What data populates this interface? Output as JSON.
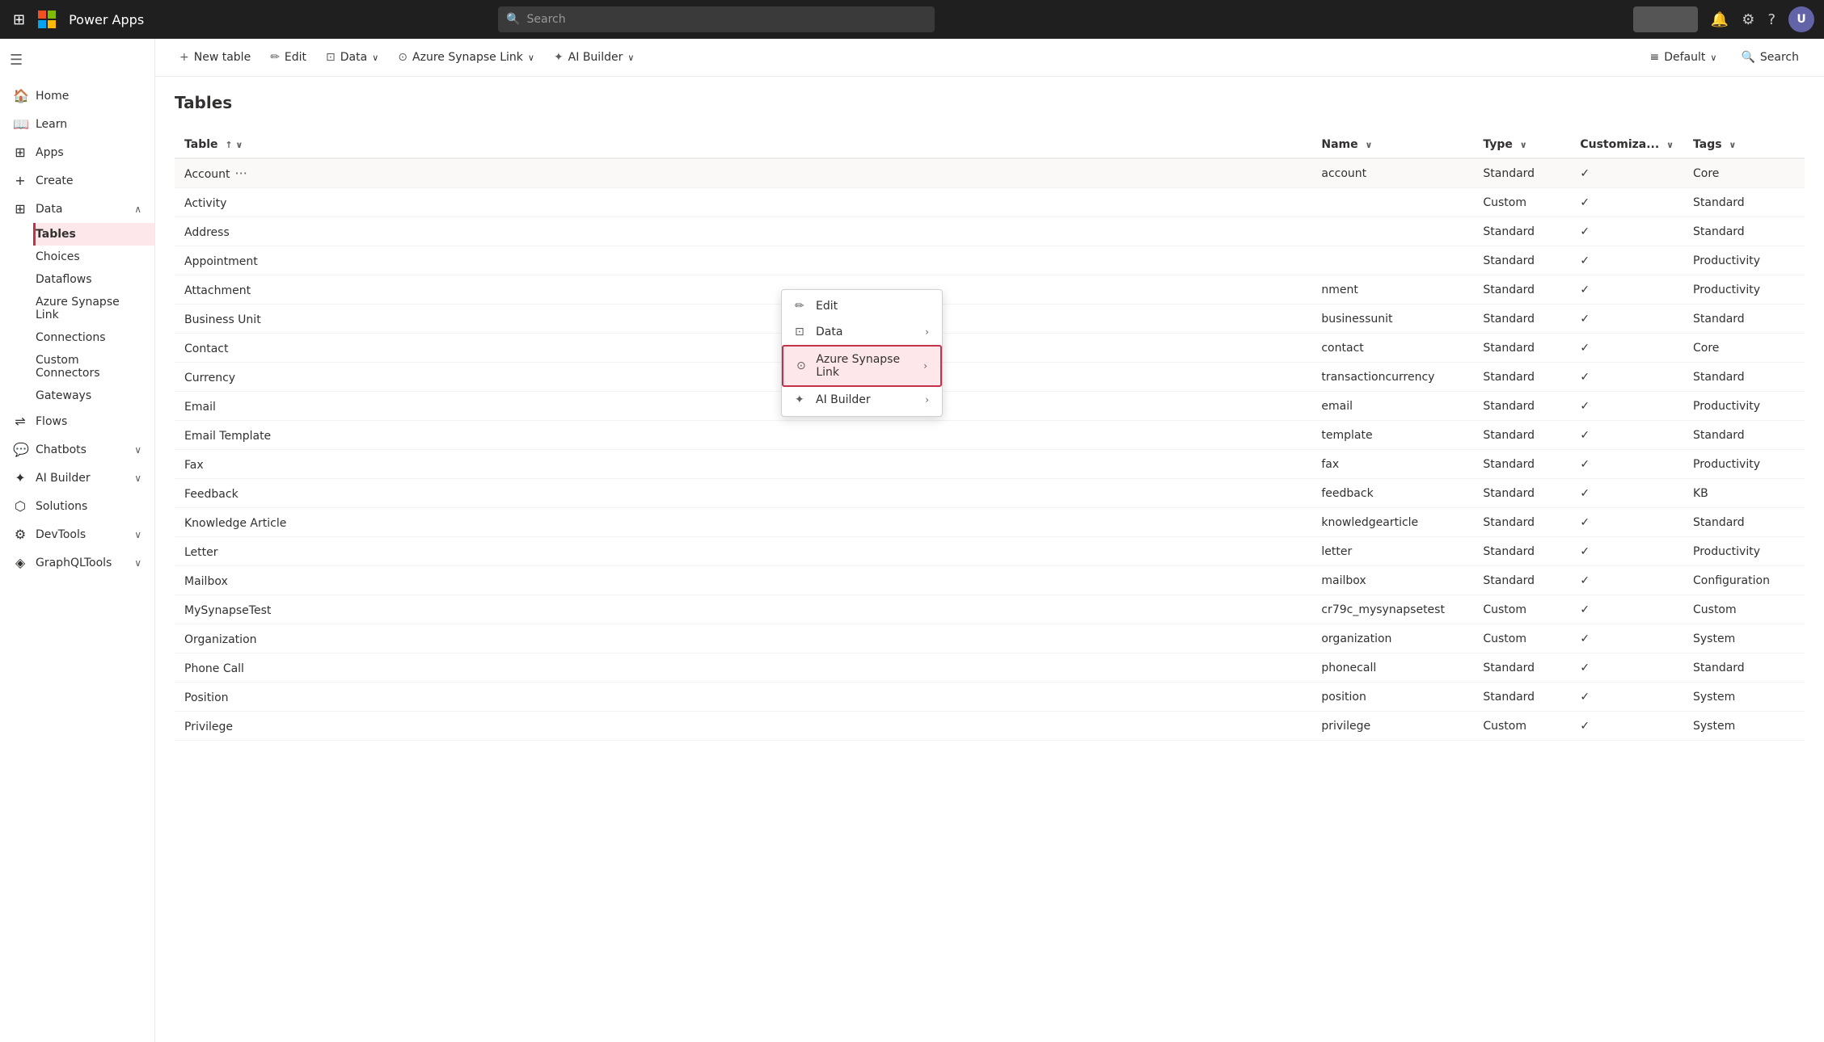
{
  "topNav": {
    "appTitle": "Power Apps",
    "searchPlaceholder": "Search",
    "waffleIcon": "⊞"
  },
  "sidebar": {
    "collapseIcon": "☰",
    "items": [
      {
        "id": "home",
        "label": "Home",
        "icon": "🏠"
      },
      {
        "id": "learn",
        "label": "Learn",
        "icon": "📖"
      },
      {
        "id": "apps",
        "label": "Apps",
        "icon": "⊞"
      },
      {
        "id": "create",
        "label": "Create",
        "icon": "+"
      },
      {
        "id": "data",
        "label": "Data",
        "icon": "⊞",
        "expanded": true,
        "hasChevron": true,
        "chevron": "∧"
      },
      {
        "id": "flows",
        "label": "Flows",
        "icon": "⇌"
      },
      {
        "id": "chatbots",
        "label": "Chatbots",
        "icon": "💬",
        "hasChevron": true,
        "chevron": "∨"
      },
      {
        "id": "ai-builder",
        "label": "AI Builder",
        "icon": "✦",
        "hasChevron": true,
        "chevron": "∨"
      },
      {
        "id": "solutions",
        "label": "Solutions",
        "icon": "⬡"
      },
      {
        "id": "devtools",
        "label": "DevTools",
        "icon": "⚙",
        "hasChevron": true,
        "chevron": "∨"
      },
      {
        "id": "graphqltools",
        "label": "GraphQLTools",
        "icon": "◈",
        "hasChevron": true,
        "chevron": "∨"
      }
    ],
    "dataSubItems": [
      {
        "id": "tables",
        "label": "Tables",
        "active": true
      },
      {
        "id": "choices",
        "label": "Choices"
      },
      {
        "id": "dataflows",
        "label": "Dataflows"
      },
      {
        "id": "azure-synapse-link",
        "label": "Azure Synapse Link"
      },
      {
        "id": "connections",
        "label": "Connections"
      },
      {
        "id": "custom-connectors",
        "label": "Custom Connectors"
      },
      {
        "id": "gateways",
        "label": "Gateways"
      }
    ]
  },
  "toolbar": {
    "newTableLabel": "+ New table",
    "editLabel": "✏ Edit",
    "dataLabel": "⊡ Data",
    "azureSynapseLinkLabel": "⊙ Azure Synapse Link",
    "aiBuilderLabel": "✦ AI Builder",
    "defaultLabel": "≡ Default",
    "searchLabel": "🔍 Search"
  },
  "pageTitle": "Tables",
  "tableColumns": [
    {
      "id": "table",
      "label": "Table",
      "sortIcon": "↑ ∨"
    },
    {
      "id": "name",
      "label": "Name",
      "sortIcon": "∨"
    },
    {
      "id": "type",
      "label": "Type",
      "sortIcon": "∨"
    },
    {
      "id": "customizable",
      "label": "Customiza...",
      "sortIcon": "∨"
    },
    {
      "id": "tags",
      "label": "Tags",
      "sortIcon": "∨"
    }
  ],
  "tableRows": [
    {
      "table": "Account",
      "name": "account",
      "type": "Standard",
      "customizable": true,
      "tags": "Core",
      "highlighted": true
    },
    {
      "table": "Activity",
      "name": "",
      "type": "Custom",
      "customizable": true,
      "tags": "Standard"
    },
    {
      "table": "Address",
      "name": "",
      "type": "Standard",
      "customizable": true,
      "tags": "Standard"
    },
    {
      "table": "Appointment",
      "name": "",
      "type": "Standard",
      "customizable": true,
      "tags": "Productivity"
    },
    {
      "table": "Attachment",
      "name": "nment",
      "type": "Standard",
      "customizable": true,
      "tags": "Productivity"
    },
    {
      "table": "Business Unit",
      "name": "businessunit",
      "type": "Standard",
      "customizable": true,
      "tags": "Standard"
    },
    {
      "table": "Contact",
      "name": "contact",
      "type": "Standard",
      "customizable": true,
      "tags": "Core"
    },
    {
      "table": "Currency",
      "name": "transactioncurrency",
      "type": "Standard",
      "customizable": true,
      "tags": "Standard"
    },
    {
      "table": "Email",
      "name": "email",
      "type": "Standard",
      "customizable": true,
      "tags": "Productivity"
    },
    {
      "table": "Email Template",
      "name": "template",
      "type": "Standard",
      "customizable": true,
      "tags": "Standard"
    },
    {
      "table": "Fax",
      "name": "fax",
      "type": "Standard",
      "customizable": true,
      "tags": "Productivity"
    },
    {
      "table": "Feedback",
      "name": "feedback",
      "type": "Standard",
      "customizable": true,
      "tags": "KB"
    },
    {
      "table": "Knowledge Article",
      "name": "knowledgearticle",
      "type": "Standard",
      "customizable": true,
      "tags": "Standard"
    },
    {
      "table": "Letter",
      "name": "letter",
      "type": "Standard",
      "customizable": true,
      "tags": "Productivity"
    },
    {
      "table": "Mailbox",
      "name": "mailbox",
      "type": "Standard",
      "customizable": true,
      "tags": "Configuration"
    },
    {
      "table": "MySynapseTest",
      "name": "cr79c_mysynapsetest",
      "type": "Custom",
      "customizable": true,
      "tags": "Custom"
    },
    {
      "table": "Organization",
      "name": "organization",
      "type": "Custom",
      "customizable": true,
      "tags": "System"
    },
    {
      "table": "Phone Call",
      "name": "phonecall",
      "type": "Standard",
      "customizable": true,
      "tags": "Standard"
    },
    {
      "table": "Position",
      "name": "position",
      "type": "Standard",
      "customizable": true,
      "tags": "System"
    },
    {
      "table": "Privilege",
      "name": "privilege",
      "type": "Custom",
      "customizable": true,
      "tags": "System"
    }
  ],
  "contextMenu": {
    "visible": true,
    "topPx": 200,
    "leftPx": 760,
    "items": [
      {
        "id": "edit",
        "label": "Edit",
        "icon": "✏",
        "highlighted": false
      },
      {
        "id": "data",
        "label": "Data",
        "icon": "⊡",
        "highlighted": false,
        "hasArrow": true
      },
      {
        "id": "azure-synapse-link",
        "label": "Azure Synapse Link",
        "icon": "⊙",
        "highlighted": true,
        "hasArrow": true
      },
      {
        "id": "ai-builder",
        "label": "AI Builder",
        "icon": "✦",
        "highlighted": false,
        "hasArrow": true
      }
    ]
  }
}
